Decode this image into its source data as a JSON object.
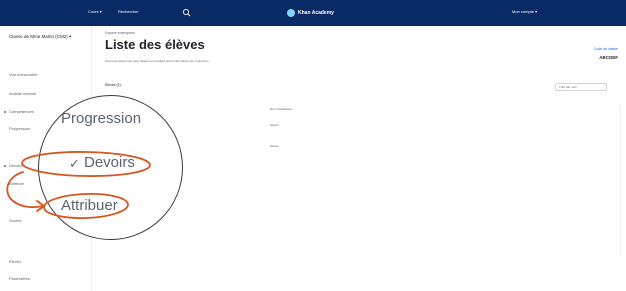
{
  "header": {
    "nav_cours": "Cours",
    "nav_rechercher": "Rechercher",
    "brand": "Khan Academy",
    "user_menu": "Mon compte"
  },
  "sidebar": {
    "class_name": "Classe de Mme Martin (CM2) ▾",
    "items": [
      "Vue d'ensemble",
      "Activité récente",
      "Compétences",
      "Progression",
      "Devoirs",
      "Attribuer",
      "Scores",
      "Élèves",
      "Paramètres"
    ]
  },
  "main": {
    "breadcrumb": "Espace enseignant",
    "title": "Liste des élèves",
    "subtitle": "Gérez les élèves de votre classe et consultez leurs informations de connexion.",
    "class_code_label": "Code de classe",
    "class_code": "ABCDEF",
    "students_label": "Élèves (2)",
    "sort_select": "Trier par nom",
    "col1": [
      "Nom de l'élève"
    ],
    "col2": [
      "Nom d'utilisateur",
      "élève1",
      "élève2"
    ]
  },
  "magnifier": {
    "progression": "Progression",
    "devoirs": "Devoirs",
    "attribuer": "Attribuer",
    "check": "✓"
  },
  "colors": {
    "header_bg": "#0a2a66",
    "annotation": "#d9541e"
  }
}
